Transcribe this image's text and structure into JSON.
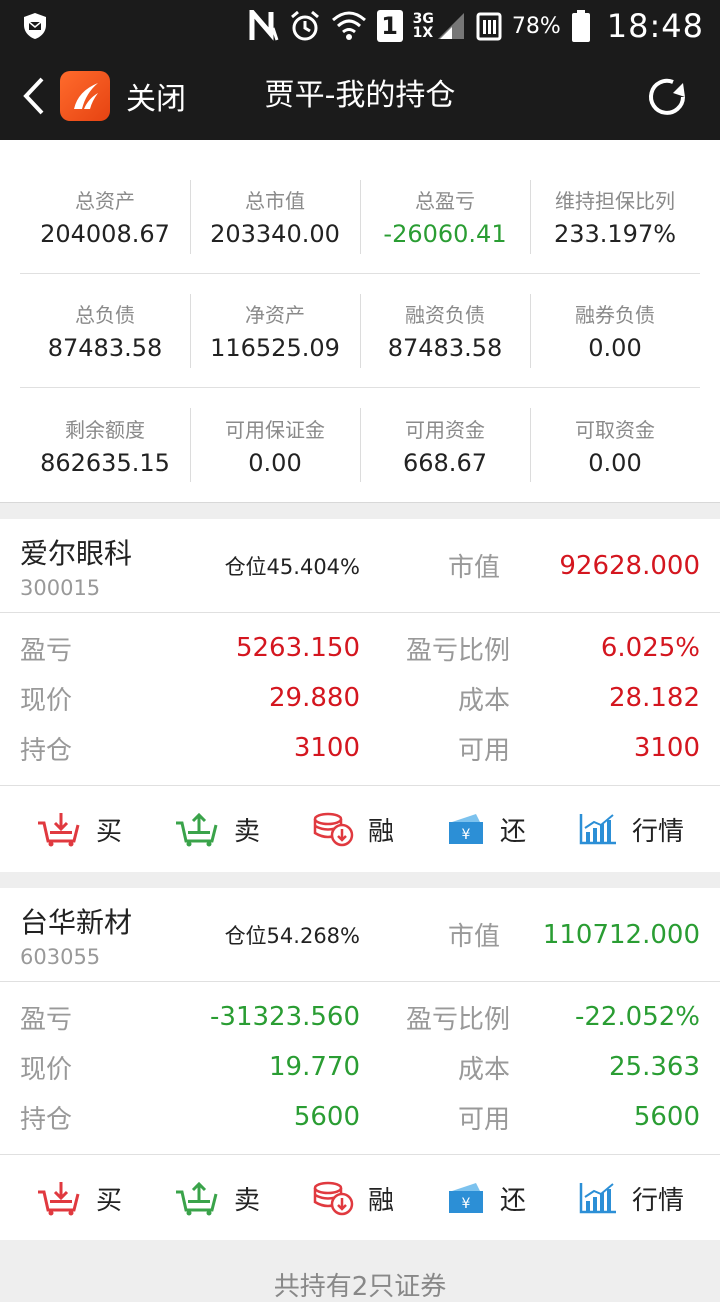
{
  "statusbar": {
    "network": "3G\n1X",
    "sim": "1",
    "battery": "78%",
    "time": "18:48"
  },
  "topbar": {
    "close_label": "关闭",
    "title": "贾平-我的持仓"
  },
  "summary": {
    "rows": [
      [
        {
          "label": "总资产",
          "value": "204008.67"
        },
        {
          "label": "总市值",
          "value": "203340.00"
        },
        {
          "label": "总盈亏",
          "value": "-26060.41"
        },
        {
          "label": "维持担保比列",
          "value": "233.197%"
        }
      ],
      [
        {
          "label": "总负债",
          "value": "87483.58"
        },
        {
          "label": "净资产",
          "value": "116525.09"
        },
        {
          "label": "融资负债",
          "value": "87483.58"
        },
        {
          "label": "融券负债",
          "value": "0.00"
        }
      ],
      [
        {
          "label": "剩余额度",
          "value": "862635.15"
        },
        {
          "label": "可用保证金",
          "value": "0.00"
        },
        {
          "label": "可用资金",
          "value": "668.67"
        },
        {
          "label": "可取资金",
          "value": "0.00"
        }
      ]
    ]
  },
  "labels": {
    "market_value": "市值",
    "pnl": "盈亏",
    "pnl_ratio": "盈亏比例",
    "price": "现价",
    "cost": "成本",
    "holding": "持仓",
    "available": "可用"
  },
  "actions": {
    "buy": "买",
    "sell": "卖",
    "margin": "融",
    "repay": "还",
    "quote": "行情"
  },
  "holdings": [
    {
      "name": "爱尔眼科",
      "code": "300015",
      "position": "仓位45.404%",
      "market_value": "92628.000",
      "pnl": "5263.150",
      "pnl_ratio": "6.025%",
      "price": "29.880",
      "cost": "28.182",
      "holding": "3100",
      "available": "3100",
      "color": "#d4161f"
    },
    {
      "name": "台华新材",
      "code": "603055",
      "position": "仓位54.268%",
      "market_value": "110712.000",
      "pnl": "-31323.560",
      "pnl_ratio": "-22.052%",
      "price": "19.770",
      "cost": "25.363",
      "holding": "5600",
      "available": "5600",
      "color": "#2a9d33"
    }
  ],
  "footer": {
    "text": "共持有2只证券"
  }
}
